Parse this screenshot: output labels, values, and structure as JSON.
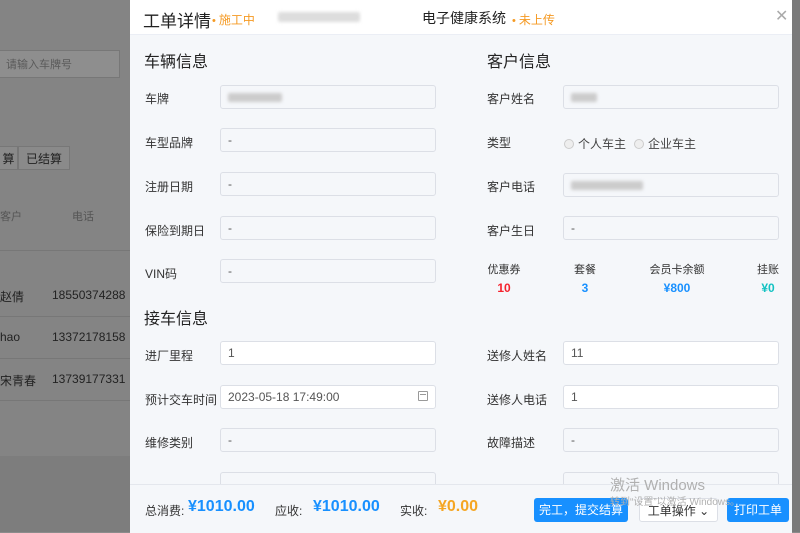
{
  "background": {
    "search_placeholder": "请输入车牌号",
    "tabs": [
      "算",
      "已结算"
    ],
    "columns": [
      "客户",
      "电话"
    ],
    "rows": [
      {
        "name": "赵倩",
        "phone": "18550374288"
      },
      {
        "name": "hao",
        "phone": "13372178158"
      },
      {
        "name": "宋青春",
        "phone": "13739177331"
      }
    ]
  },
  "header": {
    "title": "工单详情",
    "order_status": "施工中",
    "system_name": "电子健康系统",
    "upload_status": "未上传",
    "close_icon": "close-icon"
  },
  "vehicle": {
    "section_title": "车辆信息",
    "plate_label": "车牌",
    "brand_label": "车型品牌",
    "brand_value": "-",
    "reg_date_label": "注册日期",
    "reg_date_value": "-",
    "insurance_label": "保险到期日",
    "insurance_value": "-",
    "vin_label": "VIN码",
    "vin_value": "-"
  },
  "customer": {
    "section_title": "客户信息",
    "name_label": "客户姓名",
    "type_label": "类型",
    "type_options": [
      "个人车主",
      "企业车主"
    ],
    "phone_label": "客户电话",
    "birthday_label": "客户生日",
    "birthday_value": "-",
    "stats": [
      {
        "title": "优惠券",
        "value": "10",
        "color": "#f5222d"
      },
      {
        "title": "套餐",
        "value": "3",
        "color": "#1890ff"
      },
      {
        "title": "会员卡余额",
        "value": "¥800",
        "color": "#1890ff"
      },
      {
        "title": "挂账",
        "value": "¥0",
        "color": "#13c2c2"
      }
    ]
  },
  "pickup": {
    "section_title": "接车信息",
    "mileage_label": "进厂里程",
    "mileage_value": "1",
    "delivery_label": "预计交车时间",
    "delivery_value": "2023-05-18 17:49:00",
    "calendar_icon": "calendar-icon",
    "repair_type_label": "维修类别",
    "repair_type_value": "-",
    "sender_name_label": "送修人姓名",
    "sender_name_value": "11",
    "sender_phone_label": "送修人电话",
    "sender_phone_value": "1",
    "fault_label": "故障描述",
    "fault_value": "-"
  },
  "footer": {
    "total_label": "总消费:",
    "total_value": "¥1010.00",
    "due_label": "应收:",
    "due_value": "¥1010.00",
    "paid_label": "实收:",
    "paid_value": "¥0.00",
    "complete_btn": "完工，提交结算",
    "operation_btn": "工单操作",
    "print_btn": "打印工单"
  },
  "watermark": {
    "line1": "激活 Windows",
    "line2": "转到“设置”以激活 Windows。"
  },
  "colors": {
    "accent": "#1890ff",
    "status_orange": "#f59a23",
    "paid_orange": "#f5a623"
  }
}
